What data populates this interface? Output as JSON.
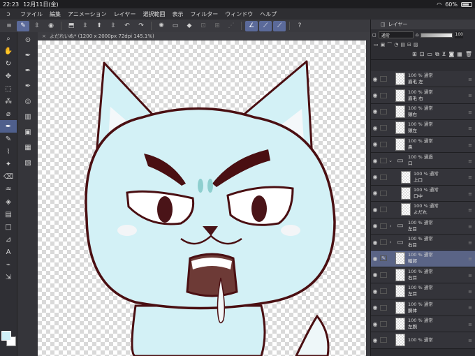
{
  "status": {
    "time": "22:23",
    "date": "12月11日(金)",
    "wifi": "wifi-icon",
    "battery": "60%"
  },
  "menu": [
    "ファイル",
    "編集",
    "アニメーション",
    "レイヤー",
    "選択範囲",
    "表示",
    "フィルター",
    "ウィンドウ",
    "ヘルプ"
  ],
  "document": {
    "tab_title": "よだれいぬ* (1200 x 2000px 72dpi 145.1%)"
  },
  "layer_panel": {
    "title": "レイヤー",
    "blend_mode": "通常",
    "opacity": "100"
  },
  "layers": [
    {
      "mode": "100 % 通常",
      "name": "眉毛 左",
      "type": "layer",
      "indent": false,
      "selected": false
    },
    {
      "mode": "100 % 通常",
      "name": "眉毛 右",
      "type": "layer",
      "indent": false,
      "selected": false
    },
    {
      "mode": "100 % 通常",
      "name": "頬右",
      "type": "layer",
      "indent": false,
      "selected": false
    },
    {
      "mode": "100 % 通常",
      "name": "頬左",
      "type": "layer",
      "indent": false,
      "selected": false
    },
    {
      "mode": "100 % 通常",
      "name": "鼻",
      "type": "layer",
      "indent": false,
      "selected": false
    },
    {
      "mode": "100 % 通過",
      "name": "口",
      "type": "folder",
      "indent": false,
      "selected": false
    },
    {
      "mode": "100 % 通常",
      "name": "上口",
      "type": "layer",
      "indent": true,
      "selected": false
    },
    {
      "mode": "100 % 通常",
      "name": "口中",
      "type": "layer",
      "indent": true,
      "selected": false
    },
    {
      "mode": "100 % 通常",
      "name": "よだれ",
      "type": "layer",
      "indent": true,
      "selected": false
    },
    {
      "mode": "100 % 通常",
      "name": "左目",
      "type": "folder",
      "indent": false,
      "selected": false
    },
    {
      "mode": "100 % 通常",
      "name": "右目",
      "type": "folder",
      "indent": false,
      "selected": false
    },
    {
      "mode": "100 % 通常",
      "name": "輪郭",
      "type": "layer",
      "indent": false,
      "selected": true
    },
    {
      "mode": "100 % 通常",
      "name": "右耳",
      "type": "layer",
      "indent": false,
      "selected": false
    },
    {
      "mode": "100 % 通常",
      "name": "左耳",
      "type": "layer",
      "indent": false,
      "selected": false
    },
    {
      "mode": "100 % 通常",
      "name": "胴体",
      "type": "layer",
      "indent": false,
      "selected": false
    },
    {
      "mode": "100 % 通常",
      "name": "左腕",
      "type": "layer",
      "indent": false,
      "selected": false
    },
    {
      "mode": "100 % 通常",
      "name": "",
      "type": "layer",
      "indent": false,
      "selected": false
    }
  ],
  "colors": {
    "main": "#cfeff7",
    "sub": "#ffffff",
    "accent": "#5b6a9a",
    "fur": "#d3f1f6",
    "outline": "#4a0f12"
  }
}
